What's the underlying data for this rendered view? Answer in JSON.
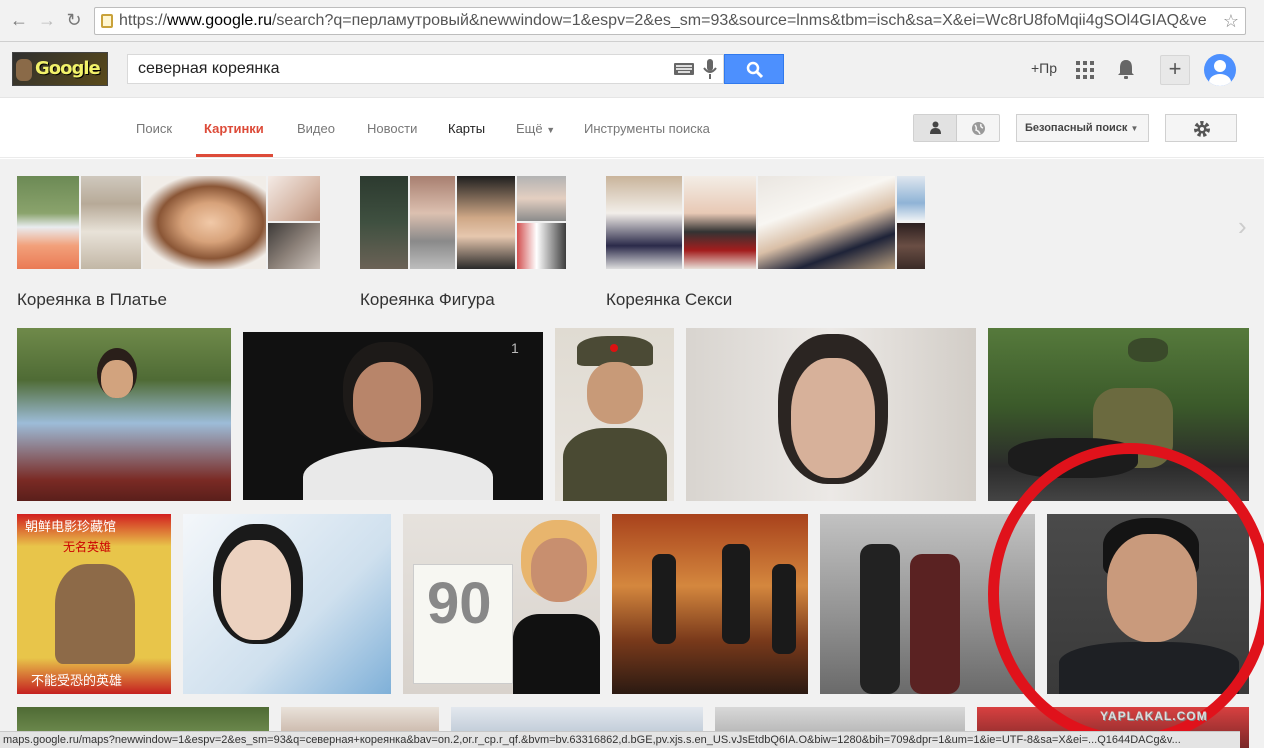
{
  "browser": {
    "url_prefix": "https://",
    "url_host": "www.google.ru",
    "url_rest": "/search?q=перламутровый&newwindow=1&espv=2&es_sm=93&source=lnms&tbm=isch&sa=X&ei=Wc8rU8foMqii4gSOl4GIAQ&ve"
  },
  "header": {
    "logo_text": "Google",
    "search_value": "северная кореянка",
    "plus_label": "+Пр"
  },
  "tabs": {
    "items": [
      "Поиск",
      "Картинки",
      "Видео",
      "Новости",
      "Карты",
      "Ещё",
      "Инструменты поиска"
    ],
    "active": "Картинки",
    "safe_search": "Безопасный поиск"
  },
  "related": [
    {
      "label": "Кореянка в Платье"
    },
    {
      "label": "Кореянка Фигура"
    },
    {
      "label": "Кореянка Секси"
    }
  ],
  "results": {
    "row2_poster_text_top": "朝鲜电影珍藏馆",
    "row2_poster_text_bottom": "不能受恐的英雄",
    "row2_poster_title": "无名英雄",
    "calendar_number": "90"
  },
  "status_bar": "maps.google.ru/maps?newwindow=1&espv=2&es_sm=93&q=северная+кореянка&bav=on.2,or.r_cp.r_qf.&bvm=bv.63316862,d.bGE,pv.xjs.s.en_US.vJsEtdbQ6IA.O&biw=1280&bih=709&dpr=1&um=1&ie=UTF-8&sa=X&ei=...Q1644DACg&v...",
  "watermark": "YAPLAKAL.COM",
  "colors": {
    "accent": "#dd4b39",
    "search_blue": "#4d90fe",
    "annotation_red": "#e0121b"
  }
}
